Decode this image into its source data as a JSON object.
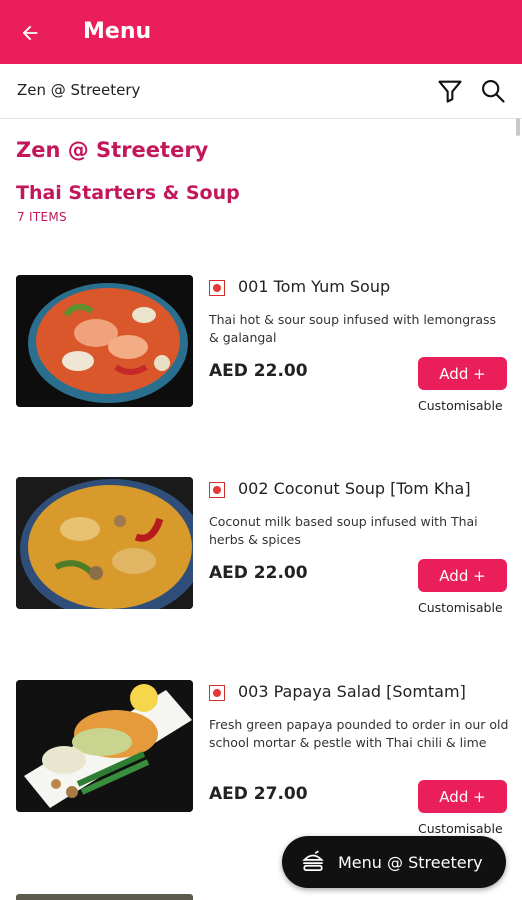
{
  "appbar": {
    "title": "Menu",
    "back_icon": "arrow-left-icon"
  },
  "subbar": {
    "title": "Zen @ Streetery",
    "filter_icon": "filter-icon",
    "search_icon": "search-icon"
  },
  "restaurant": {
    "name": "Zen @ Streetery"
  },
  "section": {
    "title": "Thai Starters & Soup",
    "count": "7 ITEMS"
  },
  "items": [
    {
      "name": "001 Tom Yum Soup",
      "description": "Thai hot & sour soup infused with lemongrass & galangal",
      "price": "AED 22.00",
      "add_label": "Add +",
      "custom_label": "Customisable"
    },
    {
      "name": "002  Coconut Soup [Tom Kha]",
      "description": "Coconut milk based soup infused with Thai herbs & spices",
      "price": "AED 22.00",
      "add_label": "Add +",
      "custom_label": "Customisable"
    },
    {
      "name": "003  Papaya Salad [Somtam]",
      "description": "Fresh green papaya pounded to order in our old school mortar & pestle with Thai chili & lime",
      "price": "AED 27.00",
      "add_label": "Add +",
      "custom_label": "Customisable"
    }
  ],
  "fab": {
    "label": "Menu @ Streetery",
    "icon": "burger-icon"
  },
  "colors": {
    "brand": "#e91e5a",
    "heading": "#c2185b",
    "veg_mark": "#e53935"
  }
}
